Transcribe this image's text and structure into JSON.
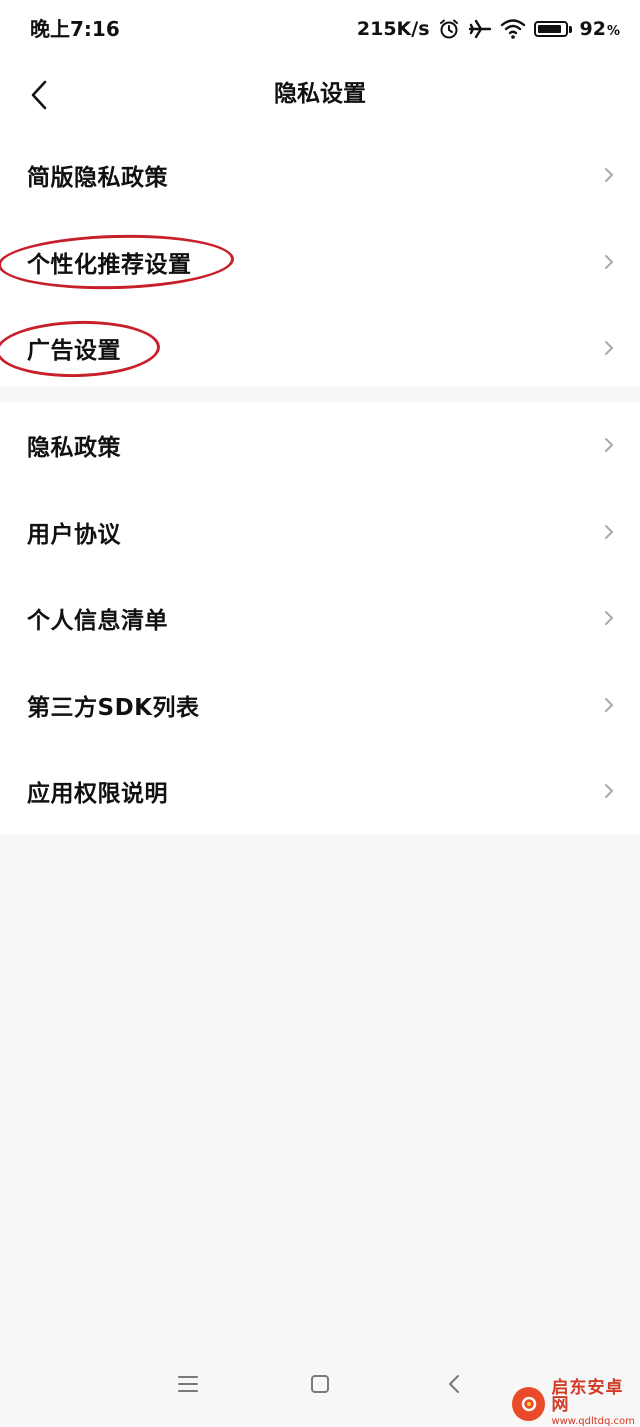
{
  "status_bar": {
    "time": "晚上7:16",
    "net_speed": "215K/s",
    "icons": [
      "alarm-icon",
      "airplane-icon",
      "wifi-icon",
      "battery-icon"
    ],
    "battery_level": 0.92,
    "battery_percent": "92",
    "battery_percent_sign": "%"
  },
  "header": {
    "title": "隐私设置",
    "back_icon": "chevron-left-icon"
  },
  "group1": {
    "items": [
      {
        "label": "简版隐私政策",
        "highlighted": false
      },
      {
        "label": "个性化推荐设置",
        "highlighted": true
      },
      {
        "label": "广告设置",
        "highlighted": true
      }
    ]
  },
  "group2": {
    "items": [
      {
        "label": "隐私政策"
      },
      {
        "label": "用户协议"
      },
      {
        "label": "个人信息清单"
      },
      {
        "label": "第三方SDK列表"
      },
      {
        "label": "应用权限说明"
      }
    ]
  },
  "nav_bar": {
    "icons": [
      "menu-icon",
      "home-square-icon",
      "back-triangle-icon"
    ]
  },
  "watermark": {
    "name": "启东安卓网",
    "url": "www.qdltdq.com"
  },
  "colors": {
    "background": "#f7f7f7",
    "card": "#ffffff",
    "text": "#111111",
    "chevron": "#a9a9a9",
    "highlight_circle": "#c8202a",
    "watermark": "#d23a26"
  }
}
